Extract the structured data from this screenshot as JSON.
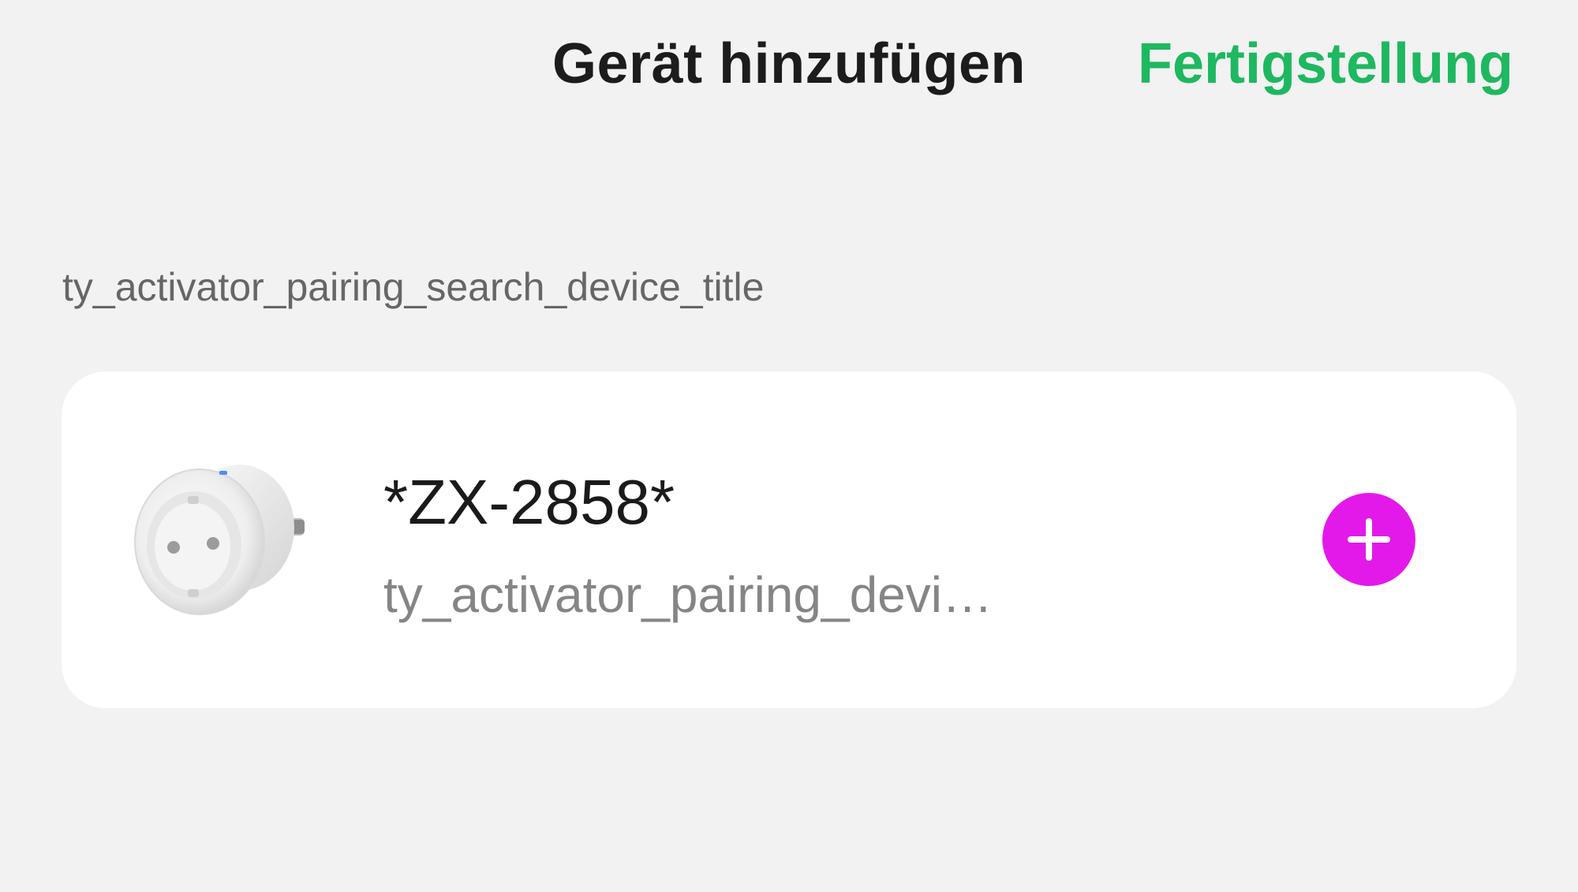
{
  "header": {
    "title": "Gerät hinzufügen",
    "done_label": "Fertigstellung",
    "done_color": "#1eb860"
  },
  "section": {
    "title": "ty_activator_pairing_search_device_title"
  },
  "devices": [
    {
      "name": "*ZX-2858*",
      "status": "ty_activator_pairing_device_will...",
      "image": "smart-plug-icon",
      "action_icon": "plus-icon",
      "action_color": "#e319ea"
    }
  ]
}
